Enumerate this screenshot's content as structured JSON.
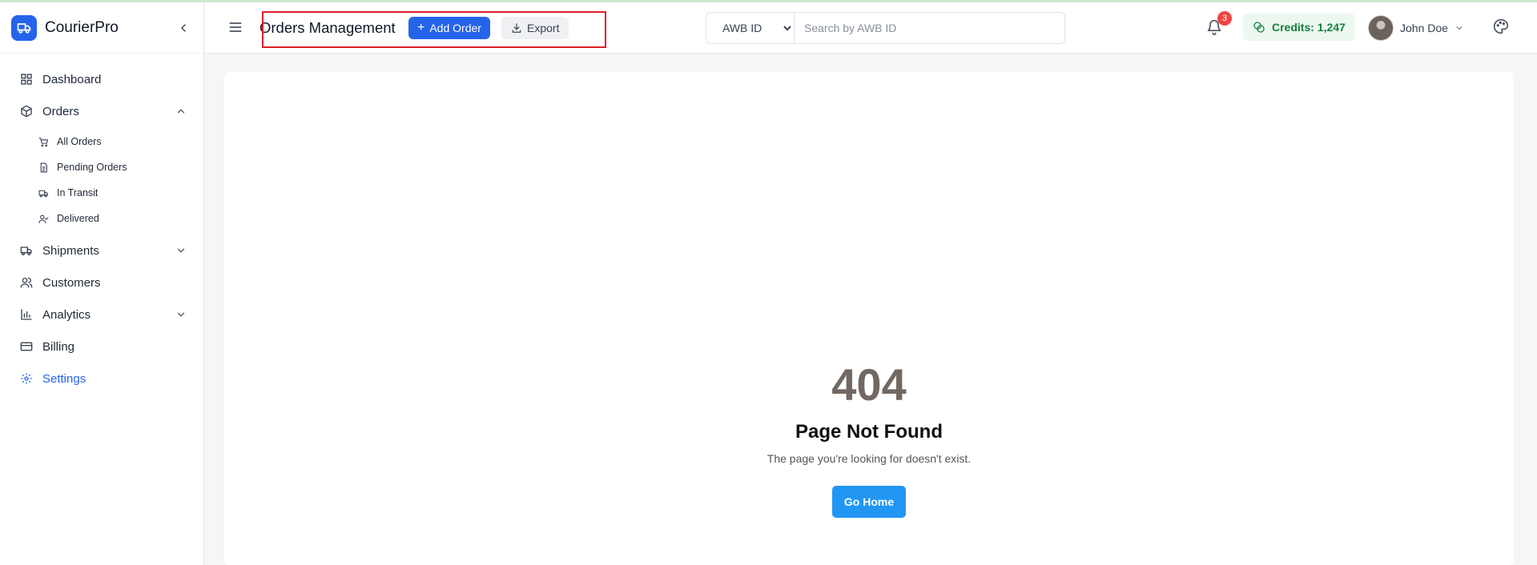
{
  "app": {
    "name": "CourierPro"
  },
  "sidebar": {
    "items": [
      {
        "label": "Dashboard",
        "icon": "grid-icon"
      },
      {
        "label": "Orders",
        "icon": "package-icon",
        "expanded": true,
        "children": [
          {
            "label": "All Orders",
            "icon": "cart-icon"
          },
          {
            "label": "Pending Orders",
            "icon": "document-icon"
          },
          {
            "label": "In Transit",
            "icon": "truck-icon"
          },
          {
            "label": "Delivered",
            "icon": "user-check-icon"
          }
        ]
      },
      {
        "label": "Shipments",
        "icon": "truck-icon",
        "expanded": false
      },
      {
        "label": "Customers",
        "icon": "users-icon"
      },
      {
        "label": "Analytics",
        "icon": "bar-chart-icon",
        "expanded": false
      },
      {
        "label": "Billing",
        "icon": "credit-card-icon"
      },
      {
        "label": "Settings",
        "icon": "gear-icon",
        "active": true
      }
    ]
  },
  "header": {
    "title": "Orders Management",
    "add_label": "Add Order",
    "export_label": "Export",
    "search": {
      "type_selected": "AWB ID",
      "type_options": [
        "AWB ID"
      ],
      "placeholder": "Search by AWB ID",
      "value": ""
    },
    "notifications_count": "3",
    "credits_label": "Credits: 1,247",
    "user_name": "John Doe"
  },
  "main": {
    "error_code": "404",
    "error_title": "Page Not Found",
    "error_message": "The page you're looking for doesn't exist.",
    "home_button": "Go Home"
  },
  "colors": {
    "primary": "#2563eb",
    "active_nav": "#2563eb",
    "credits_text": "#15803d",
    "credits_bg": "#ecf8ef",
    "badge": "#ef4444",
    "error_code": "#726862",
    "go_home": "#2196f3",
    "highlight_box": "#e11d2a"
  }
}
